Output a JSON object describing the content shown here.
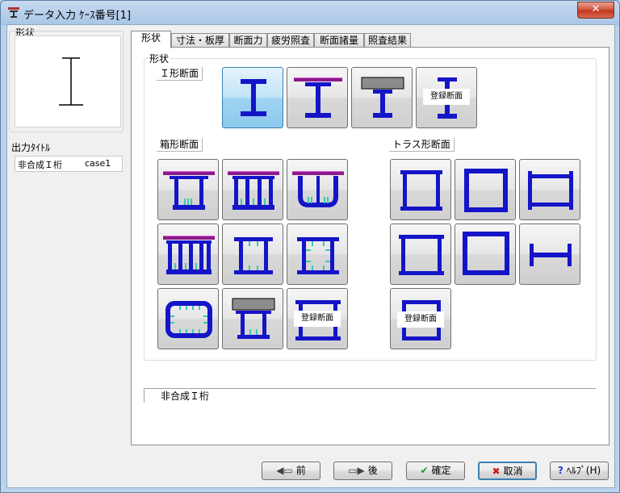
{
  "window": {
    "title": "データ入力 ｹｰｽ番号[1]",
    "close_glyph": "✕"
  },
  "left": {
    "shape_group_label": "形状",
    "output_title_label": "出力ﾀｲﾄﾙ",
    "output_title_value": "非合成Ｉ桁",
    "output_case_value": "case1"
  },
  "tabs": [
    "形状",
    "寸法・板厚",
    "断面力",
    "疲労照査",
    "断面諸量",
    "照査結果"
  ],
  "panel": {
    "group_label": "形状",
    "i_section_label": "Ｉ形断面",
    "box_section_label": "箱形断面",
    "truss_section_label": "トラス形断面",
    "registered_label": "登録断面",
    "status_text": "非合成Ｉ桁"
  },
  "buttons": {
    "prev": "前",
    "next": "後",
    "ok": "確定",
    "cancel": "取消",
    "help": "ﾍﾙﾌﾟ(H)"
  },
  "colors": {
    "steel": "#1414c8",
    "slab": "#8b1a8b",
    "slab_top": "#e060e0",
    "stiffener": "#3cc8b4",
    "concrete": "#8c8c8c",
    "selected": "#9fd4f2"
  }
}
